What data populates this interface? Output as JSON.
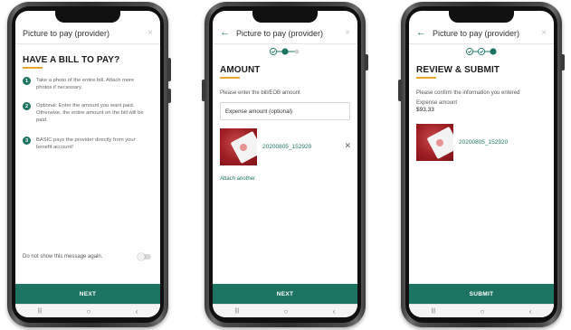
{
  "colors": {
    "primary": "#1d7462",
    "accent": "#e9a82b",
    "phone_frame": "#2e2e2e"
  },
  "nav_icons": [
    "recent-apps-icon",
    "home-icon",
    "back-icon"
  ],
  "nav_glyphs": {
    "recent": "|||",
    "home": "○",
    "back": "‹"
  },
  "phone1": {
    "title": "Picture to pay (provider)",
    "close_glyph": "×",
    "heading": "HAVE A BILL TO PAY?",
    "steps": [
      {
        "num": "1",
        "text": "Take a photo of the entire bill. Attach more photos if necessary."
      },
      {
        "num": "2",
        "text": "Optional: Enter the amount you want paid. Otherwise, the entire amount on the bill will be paid."
      },
      {
        "num": "3",
        "text": "BASIC pays the provider directly from your benefit account!"
      }
    ],
    "toggle_label": "Do not show this message again.",
    "toggle_on": false,
    "cta": "NEXT"
  },
  "phone2": {
    "back_glyph": "←",
    "title": "Picture to pay (provider)",
    "close_glyph": "×",
    "stepper_current": 2,
    "stepper_total": 3,
    "heading": "AMOUNT",
    "instruction": "Please enter the bill/EOB amount",
    "field_placeholder": "Expense amount (optional)",
    "file_name": "20200805_152920",
    "remove_glyph": "✕",
    "attach_link": "Attach another",
    "cta": "NEXT"
  },
  "phone3": {
    "back_glyph": "←",
    "title": "Picture to pay (provider)",
    "close_glyph": "×",
    "stepper_current": 3,
    "stepper_total": 3,
    "heading": "REVIEW & SUBMIT",
    "instruction": "Please confirm the information you entered",
    "amount_label": "Expense amount",
    "amount_value": "$93.33",
    "file_name": "20200805_152920",
    "cta": "SUBMIT"
  }
}
